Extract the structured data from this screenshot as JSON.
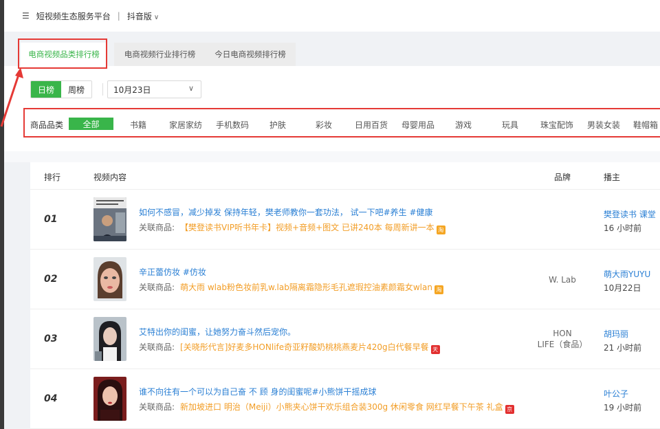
{
  "topbar": {
    "menu_icon": "☰",
    "platform": "短视频生态服务平台",
    "separator": "|",
    "version": "抖音版"
  },
  "tabs": [
    {
      "label": "电商视频品类排行榜",
      "active": true
    },
    {
      "label": "电商视频行业排行榜",
      "active": false
    },
    {
      "label": "今日电商视频排行榜",
      "active": false
    }
  ],
  "period": {
    "daily": "日榜",
    "weekly": "周榜",
    "selected": "日榜"
  },
  "date_select": {
    "value": "10月23日"
  },
  "category": {
    "label": "商品品类",
    "items": [
      "全部",
      "书籍",
      "家居家纺",
      "手机数码",
      "护肤",
      "彩妆",
      "日用百货",
      "母婴用品",
      "游戏",
      "玩具",
      "珠宝配饰",
      "男装女装",
      "鞋帽箱"
    ],
    "selected": "全部"
  },
  "table": {
    "headers": {
      "rank": "排行",
      "content": "视频内容",
      "brand": "品牌",
      "host": "播主"
    },
    "related_label": "关联商品:",
    "rows": [
      {
        "rank": "01",
        "title": "如何不感冒，减少掉发 保持年轻，樊老师教你一套功法， 试一下吧#养生 #健康",
        "product": "【樊登读书VIP听书年卡】视频+音频+图文 已讲240本 每周新讲一本",
        "shop_icon": "taobao-icon",
        "brand": "",
        "host": "樊登读书 课堂",
        "time": "16 小时前"
      },
      {
        "rank": "02",
        "title": "辛正蕾仿妆 #仿妆",
        "product": "萌大雨 wlab粉色妆前乳w.lab隔离霜隐形毛孔遮瑕控油素颜霜女wlan",
        "shop_icon": "taobao-icon",
        "brand": "W. Lab",
        "host": "萌大雨YUYU",
        "time": "10月22日"
      },
      {
        "rank": "03",
        "title": "艾特出你的闺蜜，让她努力奋斗然后宠你。",
        "product": "[关晓彤代言]好麦多HONlife奇亚籽酸奶桃桃燕麦片420g白代餐早餐",
        "shop_icon": "tmall-icon",
        "brand": "HON LIFE（食品）",
        "host": "胡玛丽",
        "time": "21 小时前"
      },
      {
        "rank": "04",
        "title": "谁不向往有一个可以为自己奋 不 顾 身的闺蜜呢#小熊饼干摇成球",
        "product": "新加坡进口 明治（Meiji）小熊夹心饼干欢乐组合装300g 休闲零食 网红早餐下午茶 礼盒",
        "shop_icon": "jd-icon",
        "brand": "",
        "host": "叶公子",
        "time": "19 小时前"
      }
    ]
  },
  "colors": {
    "accent": "#39b54a",
    "link": "#2a7fd4",
    "product": "#f29d26",
    "highlight": "#e53935"
  }
}
